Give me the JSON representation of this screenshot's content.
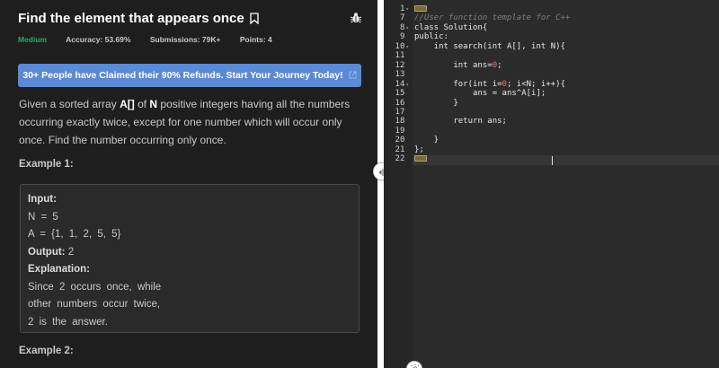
{
  "problem": {
    "title": "Find the element that appears once",
    "meta": {
      "difficulty": "Medium",
      "accuracy": "Accuracy: 53.69%",
      "submissions": "Submissions: 79K+",
      "points": "Points: 4"
    },
    "banner": "30+ People have Claimed their 90% Refunds. Start Your Journey Today!",
    "description": {
      "p1": "Given a sorted array ",
      "b1": "A[]",
      "p2": " of ",
      "b2": "N",
      "p3": " positive integers having all the numbers occurring exactly twice, except for one number which will occur only once. Find the number occurring only once."
    },
    "example1": {
      "title": "Example 1:",
      "input_label": "Input:",
      "input_n": "N = 5",
      "input_a": "A = {1, 1, 2, 5, 5}",
      "output_label": "Output:",
      "output_value": "2",
      "explanation_label": "Explanation:",
      "explanation_lines": [
        "Since 2 occurs once, while",
        "other numbers occur twice,",
        "2 is the answer."
      ]
    },
    "example2": {
      "title": "Example 2:"
    }
  },
  "editor": {
    "line_numbers": [
      "1",
      "7",
      "8",
      "9",
      "10",
      "11",
      "12",
      "13",
      "14",
      "15",
      "16",
      "17",
      "18",
      "19",
      "20",
      "21",
      "22"
    ],
    "fold_lines": [
      "1",
      "8",
      "10",
      "14"
    ],
    "lines": [
      "",
      "//User function template for C++",
      "class Solution{",
      "public:",
      "    int search(int A[], int N){",
      "",
      "        int ans=0;",
      "",
      "        for(int i=0; i<N; i++){",
      "            ans = ans^A[i];",
      "        }",
      "",
      "        return ans;",
      "",
      "    }",
      "};",
      ""
    ]
  },
  "colors": {
    "difficulty": "#2fa66a",
    "banner": "#5a8ad6",
    "editor_bg": "#2b2b2b",
    "number_literal": "#ff6b6b"
  },
  "icons": [
    "bookmark-icon",
    "bug-icon",
    "external-link-icon",
    "split-drag-icon",
    "sun-icon"
  ]
}
